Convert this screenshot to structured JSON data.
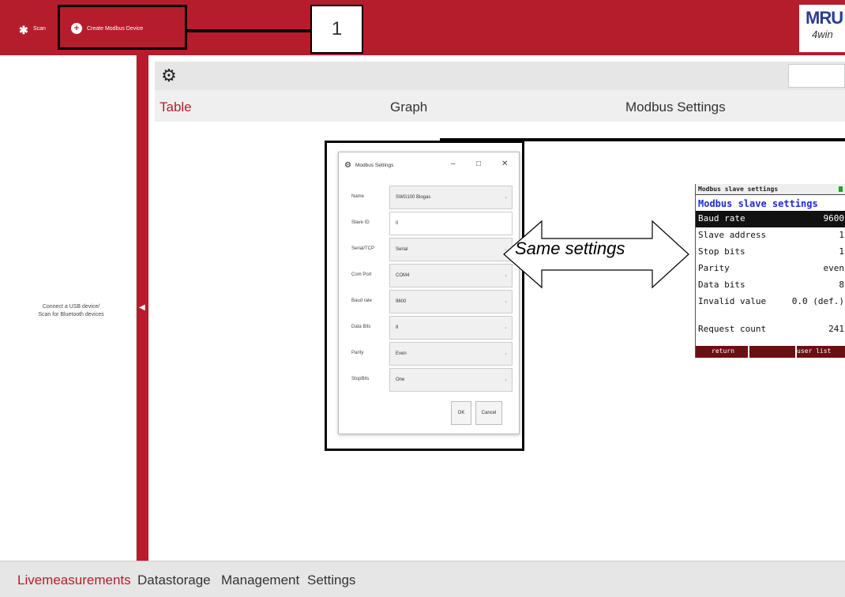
{
  "topbar": {
    "scan_label": "Scan",
    "create_label": "Create Modbus Device",
    "logo_text": "MRU",
    "logo_sub": "4win"
  },
  "callout": {
    "number": "1"
  },
  "left_panel": {
    "message_line1": "Connect a USB device/",
    "message_line2": "Scan for Bluetooth devices"
  },
  "tabs": [
    {
      "label": "Table",
      "active": true
    },
    {
      "label": "Graph",
      "active": false
    },
    {
      "label": "Modbus Settings",
      "active": false
    }
  ],
  "dialog": {
    "title": "Modbus Settings",
    "fields": [
      {
        "label": "Name",
        "value": "SWG100 Biogas"
      },
      {
        "label": "Slave ID",
        "value": "0"
      },
      {
        "label": "Serial/TCP",
        "value": "Serial"
      },
      {
        "label": "Com Port",
        "value": "COM4"
      },
      {
        "label": "Baud rate",
        "value": "9600"
      },
      {
        "label": "Data Bits",
        "value": "8"
      },
      {
        "label": "Parity",
        "value": "Even"
      },
      {
        "label": "StopBits",
        "value": "One"
      }
    ],
    "ok_label": "OK",
    "cancel_label": "Cancel"
  },
  "annotation": {
    "same_settings": "Same settings"
  },
  "device": {
    "header": "Modbus slave settings",
    "title": "Modbus slave settings",
    "rows": [
      {
        "key": "Baud rate",
        "value": "9600"
      },
      {
        "key": "Slave address",
        "value": "1"
      },
      {
        "key": "Stop bits",
        "value": "1"
      },
      {
        "key": "Parity",
        "value": "even"
      },
      {
        "key": "Data bits",
        "value": "8"
      },
      {
        "key": "Invalid value",
        "value": "0.0 (def.)"
      },
      {
        "key": "Request count",
        "value": "241"
      }
    ],
    "footer_left": "return",
    "footer_right": "user list"
  },
  "bottom_nav": [
    {
      "label": "Livemeasurements",
      "active": true
    },
    {
      "label": "Datastorage",
      "active": false
    },
    {
      "label": "Management",
      "active": false
    },
    {
      "label": "Settings",
      "active": false
    }
  ]
}
